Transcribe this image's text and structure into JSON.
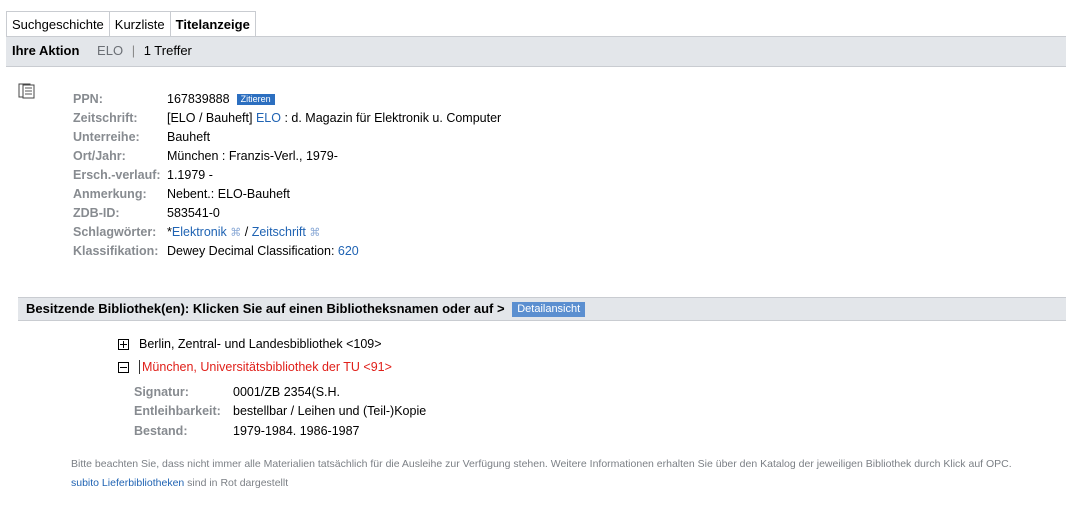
{
  "tabs": [
    {
      "label": "Suchgeschichte"
    },
    {
      "label": "Kurzliste"
    },
    {
      "label": "Titelanzeige"
    }
  ],
  "action": {
    "label": "Ihre Aktion",
    "query": "ELO",
    "separator": "|",
    "result": "1 Treffer"
  },
  "record": {
    "ppn_label": "PPN:",
    "ppn": "167839888",
    "cite_label": "Zitieren",
    "zeitschrift_label": "Zeitschrift:",
    "zeitschrift_pre": "[ELO / Bauheft]",
    "zeitschrift_link": "ELO",
    "zeitschrift_post": ": d. Magazin für Elektronik u. Computer",
    "unterreihe_label": "Unterreihe:",
    "unterreihe": "Bauheft",
    "ort_label": "Ort/Jahr:",
    "ort": "München : Franzis-Verl., 1979-",
    "ersch_label": "Ersch.-verlauf:",
    "ersch": "1.1979 -",
    "anmerkung_label": "Anmerkung:",
    "anmerkung": "Nebent.: ELO-Bauheft",
    "zdb_label": "ZDB-ID:",
    "zdb": "583541-0",
    "schlag_label": "Schlagwörter:",
    "schlag_star": "*",
    "schlag_1": "Elektronik",
    "schlag_cmd": "⌘",
    "schlag_sep": "/",
    "schlag_2": "Zeitschrift",
    "klass_label": "Klassifikation:",
    "klass_pre": "Dewey Decimal Classification:",
    "klass_link": "620"
  },
  "owners": {
    "heading": "Besitzende Bibliothek(en): Klicken Sie auf einen Bibliotheksnamen oder auf >",
    "detail_button": "Detailansicht"
  },
  "libraries": [
    {
      "name": "Berlin, Zentral- und Landesbibliothek <109>"
    },
    {
      "name": "München, Universitätsbibliothek der TU <91>"
    }
  ],
  "holdings": {
    "signatur_label": "Signatur:",
    "signatur": "0001/ZB 2354(S.H.",
    "entleih_label": "Entleihbarkeit:",
    "entleih": "bestellbar / Leihen und (Teil-)Kopie",
    "bestand_label": "Bestand:",
    "bestand": "1979-1984. 1986-1987"
  },
  "note": {
    "text": "Bitte beachten Sie, dass nicht immer alle Materialien tatsächlich für die Ausleihe zur Verfügung stehen. Weitere Informationen erhalten Sie über den Katalog der jeweiligen Bibliothek durch Klick auf OPC.",
    "link": "subito Lieferbibliotheken",
    "suffix": "sind in Rot dargestellt"
  },
  "colors": {
    "link": "#1f63b3",
    "red": "#e0201a",
    "bar": "#e3e6ea",
    "button": "#2c6fc0"
  }
}
